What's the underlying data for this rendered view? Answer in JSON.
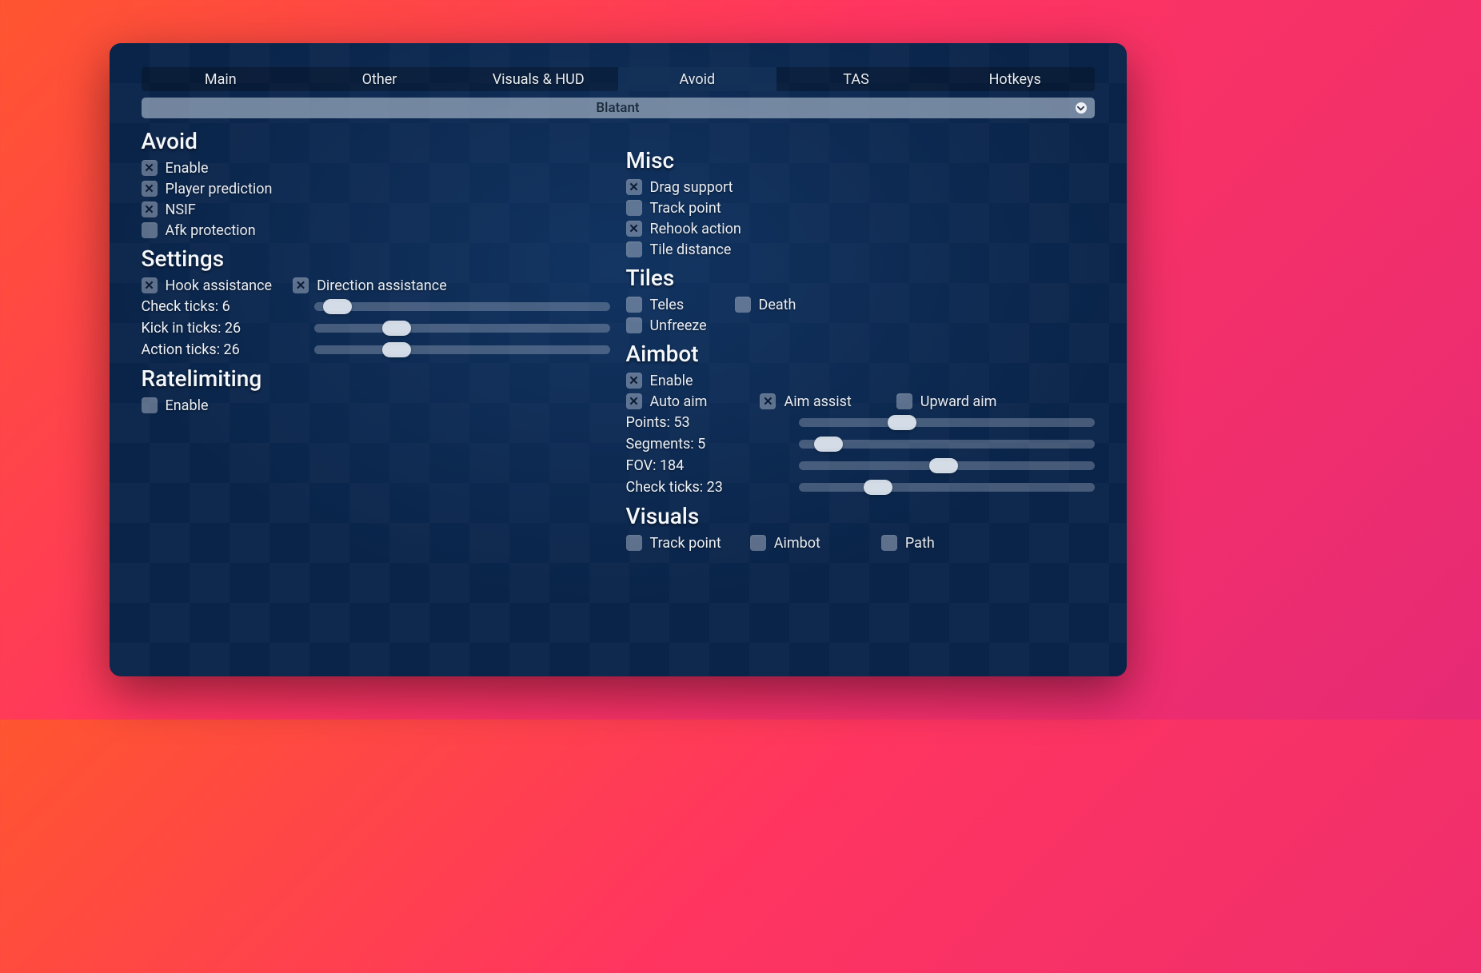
{
  "tabs": [
    "Main",
    "Other",
    "Visuals & HUD",
    "Avoid",
    "TAS",
    "Hotkeys"
  ],
  "active_tab": 3,
  "dropdown": {
    "selected": "Blatant"
  },
  "left": {
    "avoid": {
      "title": "Avoid",
      "items": [
        {
          "label": "Enable",
          "checked": true
        },
        {
          "label": "Player prediction",
          "checked": true
        },
        {
          "label": "NSIF",
          "checked": true
        },
        {
          "label": "Afk protection",
          "checked": false
        }
      ]
    },
    "settings": {
      "title": "Settings",
      "checks": [
        {
          "label": "Hook assistance",
          "checked": true
        },
        {
          "label": "Direction assistance",
          "checked": true
        }
      ],
      "sliders": [
        {
          "label": "Check ticks:",
          "value": 6,
          "pos": 8
        },
        {
          "label": "Kick in ticks:",
          "value": 26,
          "pos": 28
        },
        {
          "label": "Action ticks:",
          "value": 26,
          "pos": 28
        }
      ]
    },
    "ratelimiting": {
      "title": "Ratelimiting",
      "items": [
        {
          "label": "Enable",
          "checked": false
        }
      ]
    }
  },
  "right": {
    "misc": {
      "title": "Misc",
      "items": [
        {
          "label": "Drag support",
          "checked": true
        },
        {
          "label": "Track point",
          "checked": false
        },
        {
          "label": "Rehook action",
          "checked": true
        },
        {
          "label": "Tile distance",
          "checked": false
        }
      ]
    },
    "tiles": {
      "title": "Tiles",
      "rows": [
        [
          {
            "label": "Teles",
            "checked": false
          },
          {
            "label": "Death",
            "checked": false
          }
        ],
        [
          {
            "label": "Unfreeze",
            "checked": false
          }
        ]
      ]
    },
    "aimbot": {
      "title": "Aimbot",
      "enable": {
        "label": "Enable",
        "checked": true
      },
      "checks": [
        {
          "label": "Auto aim",
          "checked": true
        },
        {
          "label": "Aim assist",
          "checked": true
        },
        {
          "label": "Upward aim",
          "checked": false
        }
      ],
      "sliders": [
        {
          "label": "Points:",
          "value": 53,
          "pos": 35
        },
        {
          "label": "Segments:",
          "value": 5,
          "pos": 10
        },
        {
          "label": "FOV:",
          "value": 184,
          "pos": 49
        },
        {
          "label": "Check ticks:",
          "value": 23,
          "pos": 27
        }
      ]
    },
    "visuals": {
      "title": "Visuals",
      "items": [
        {
          "label": "Track point",
          "checked": false
        },
        {
          "label": "Aimbot",
          "checked": false
        },
        {
          "label": "Path",
          "checked": false
        }
      ]
    }
  }
}
